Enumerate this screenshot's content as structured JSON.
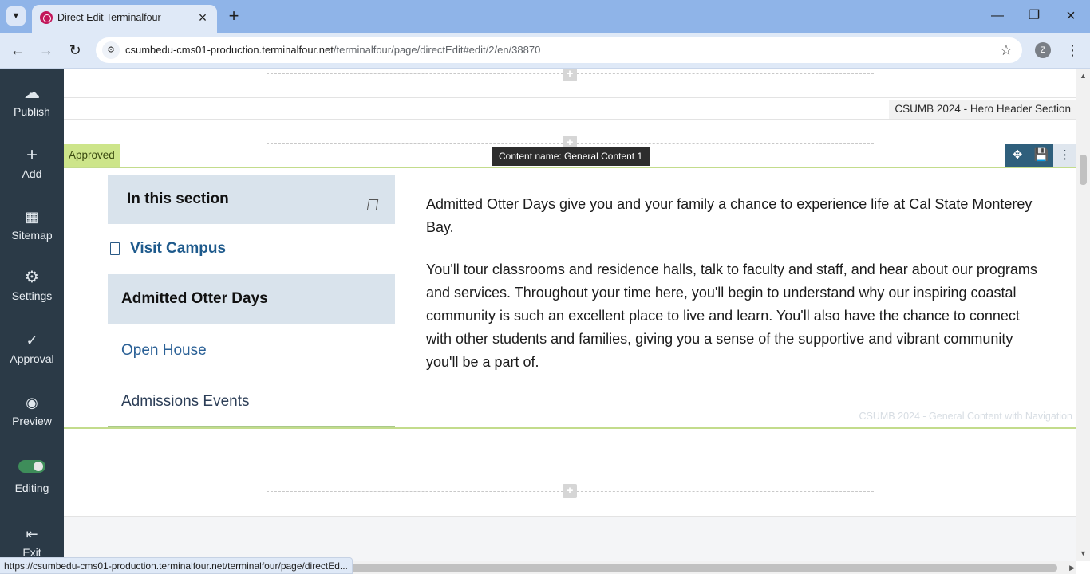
{
  "browser": {
    "tab_title": "Direct Edit Terminalfour",
    "url_host": "csumbedu-cms01-production.terminalfour.net",
    "url_path": "/terminalfour/page/directEdit#edit/2/en/38870",
    "profile_initial": "Z",
    "status_url": "https://csumbedu-cms01-production.terminalfour.net/terminalfour/page/directEd..."
  },
  "sidebar": {
    "items": [
      {
        "label": "Publish",
        "icon": "cloud-upload-icon"
      },
      {
        "label": "Add",
        "icon": "plus-icon"
      },
      {
        "label": "Sitemap",
        "icon": "sitemap-icon"
      },
      {
        "label": "Settings",
        "icon": "gear-icon"
      },
      {
        "label": "Approval",
        "icon": "check-icon"
      },
      {
        "label": "Preview",
        "icon": "eye-icon"
      },
      {
        "label": "Editing",
        "icon": "toggle-icon"
      },
      {
        "label": "Exit",
        "icon": "exit-icon"
      }
    ],
    "editing_on": true
  },
  "editor": {
    "hero_section_label": "CSUMB 2024 - Hero Header Section",
    "approved_label": "Approved",
    "content_name": "Content name: General Content 1",
    "content_template_label": "CSUMB 2024 - General Content with Navigation"
  },
  "section_nav": {
    "title": "In this section",
    "parent_link": "Visit Campus",
    "current": "Admitted Otter Days",
    "links": [
      "Open House",
      "Admissions Events"
    ]
  },
  "content": {
    "paragraphs": [
      "Admitted Otter Days give you and your family a chance to experience life at Cal State Monterey Bay.",
      "You'll tour classrooms and residence halls, talk to faculty and staff, and hear about our programs and services. Throughout your time here, you'll begin to understand why our inspiring coastal community is such an excellent place to live and learn. You'll also have the chance to connect with other students and families, giving you a sense of the supportive and vibrant community you'll be a part of."
    ]
  },
  "colors": {
    "sidebar_bg": "#2b3a47",
    "approved_bg": "#cde58a",
    "nav_highlight_bg": "#d9e3ec",
    "link_color": "#1e5a8c",
    "control_bg": "#2f5f7c"
  }
}
